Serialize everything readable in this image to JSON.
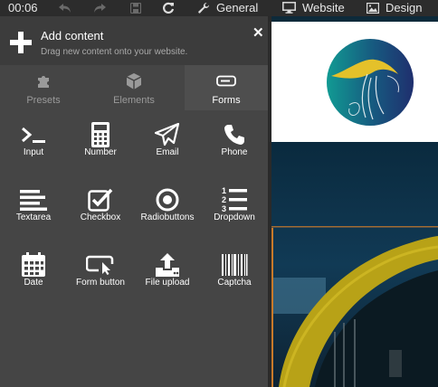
{
  "toolbar": {
    "time": "00:06",
    "undo_icon": "undo-icon",
    "redo_icon": "redo-icon",
    "save_icon": "save-icon",
    "refresh_icon": "refresh-icon",
    "general_label": "General",
    "website_label": "Website",
    "design_label": "Design"
  },
  "panel": {
    "title": "Add content",
    "subtitle": "Drag new content onto your website.",
    "close_symbol": "✕",
    "tabs": [
      {
        "label": "Presets",
        "icon": "puzzle-icon",
        "active": false
      },
      {
        "label": "Elements",
        "icon": "cube-icon",
        "active": false
      },
      {
        "label": "Forms",
        "icon": "input-field-icon",
        "active": true
      }
    ],
    "form_items": [
      {
        "label": "Input",
        "icon": "terminal-prompt-icon"
      },
      {
        "label": "Number",
        "icon": "calculator-icon"
      },
      {
        "label": "Email",
        "icon": "paper-plane-icon"
      },
      {
        "label": "Phone",
        "icon": "phone-icon"
      },
      {
        "label": "Textarea",
        "icon": "align-left-icon"
      },
      {
        "label": "Checkbox",
        "icon": "checkbox-icon"
      },
      {
        "label": "Radiobuttons",
        "icon": "radio-icon"
      },
      {
        "label": "Dropdown",
        "icon": "numbered-list-icon"
      },
      {
        "label": "Date",
        "icon": "calendar-icon"
      },
      {
        "label": "Form button",
        "icon": "button-cursor-icon"
      },
      {
        "label": "File upload",
        "icon": "upload-icon"
      },
      {
        "label": "Captcha",
        "icon": "barcode-icon"
      }
    ]
  },
  "colors": {
    "panel_bg": "#454545",
    "header_bg": "#3c3c3c",
    "toolbar_bg": "#2c2c2c",
    "logo_teal": "#0f8a8a",
    "logo_navy": "#1c2f6e",
    "logo_yellow": "#e4c12a"
  }
}
